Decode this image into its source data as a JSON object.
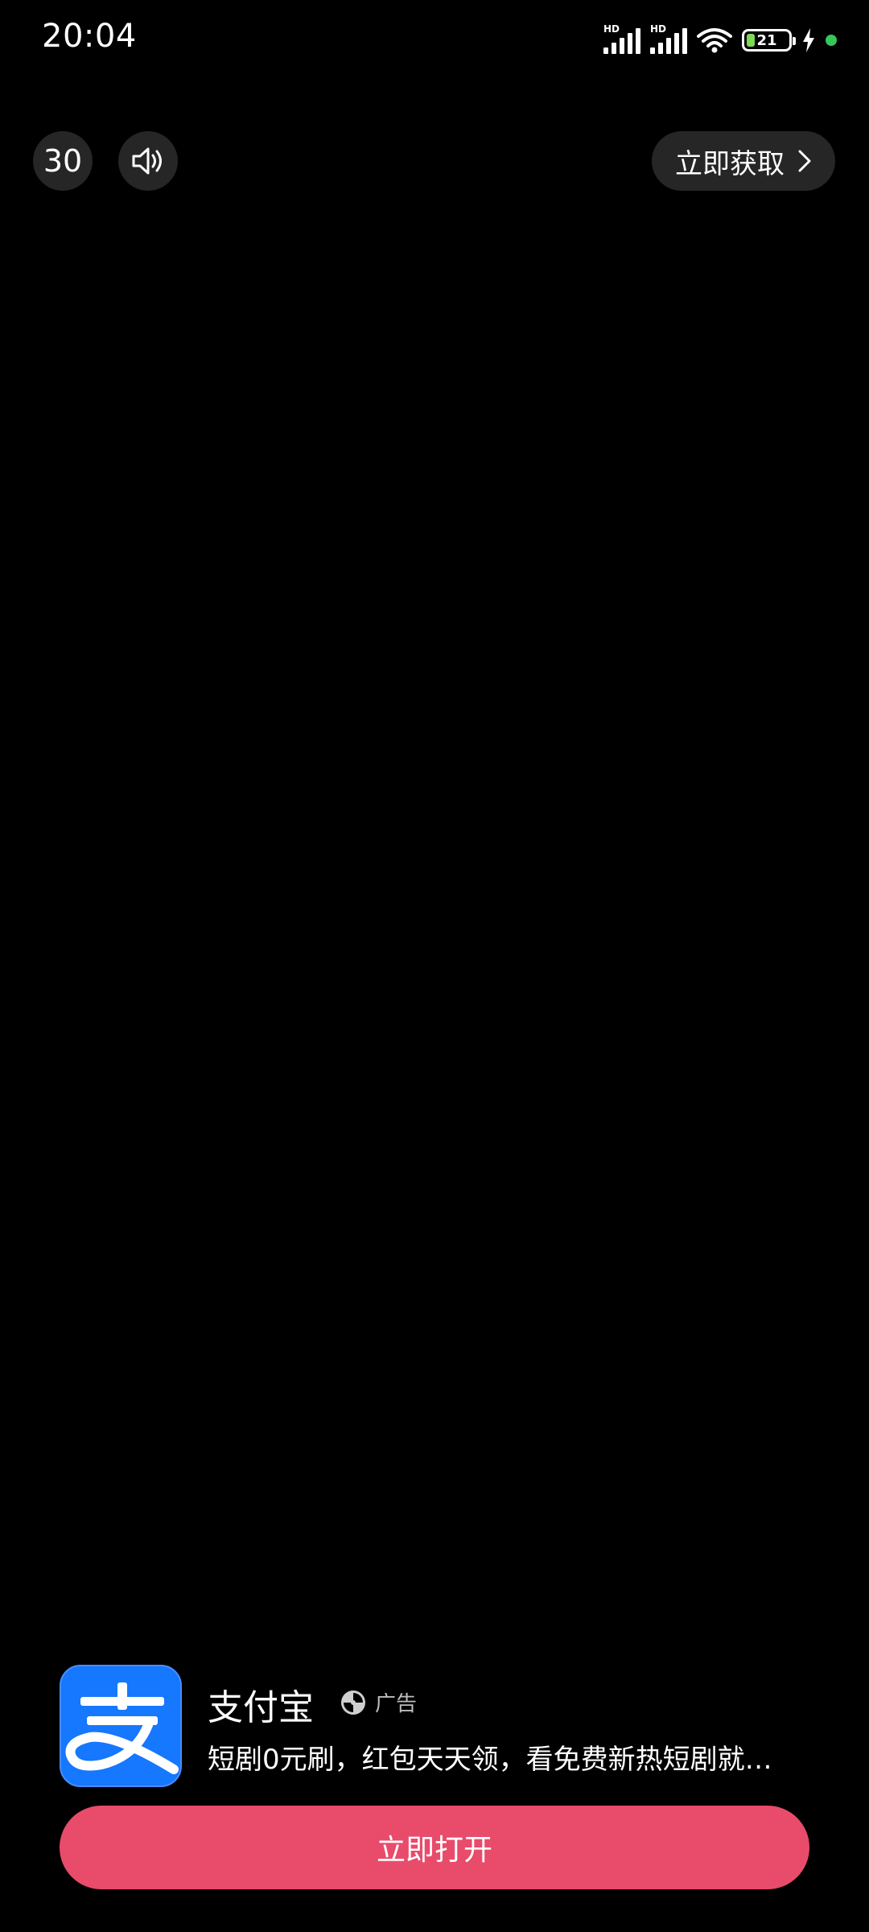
{
  "status_bar": {
    "time": "20:04",
    "signal_label_1": "HD",
    "signal_label_2": "HD",
    "battery": "21",
    "icons": [
      "signal-icon",
      "signal-icon",
      "wifi-icon",
      "battery-icon",
      "charging-icon",
      "dot-indicator"
    ]
  },
  "ad": {
    "countdown": "30",
    "sound_icon": "speaker-icon",
    "get_now_label": "立即获取",
    "app_name": "支付宝",
    "ad_label": "广告",
    "description": "短剧0元刷，红包天天领，看免费新热短剧就…",
    "open_button": "立即打开",
    "colors": {
      "open_button": "#e94b6b",
      "app_icon_bg": "#1677ff",
      "control_bg": "#262626"
    }
  }
}
